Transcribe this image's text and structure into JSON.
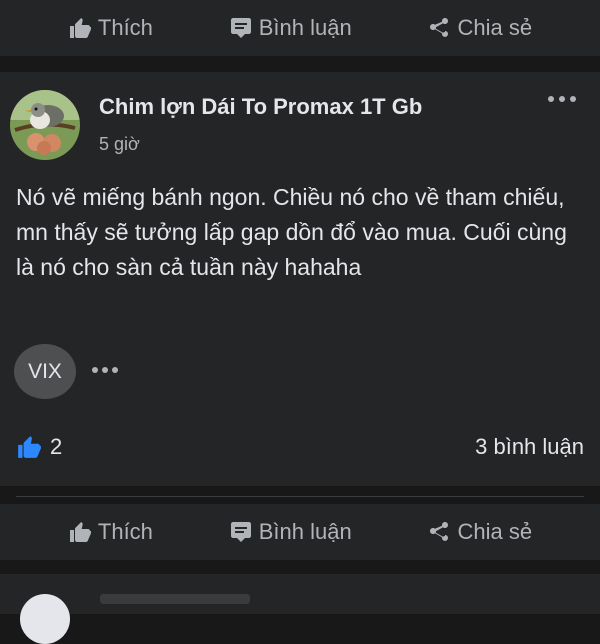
{
  "top_actions": {
    "like_label": "Thích",
    "comment_label": "Bình luận",
    "share_label": "Chia sẻ"
  },
  "post": {
    "author": "Chim lợn Dái To Promax 1T Gb",
    "time": "5 giờ",
    "body": "Nó vẽ miếng bánh ngon. Chiều nó cho về tham chiếu, mn thấy sẽ tưởng lấp gap dồn đổ vào mua. Cuối cùng là nó cho sàn cả tuần này hahaha",
    "tag": "VIX",
    "like_count": "2",
    "comment_count": "3 bình luận"
  },
  "bottom_actions": {
    "like_label": "Thích",
    "comment_label": "Bình luận",
    "share_label": "Chia sẻ"
  },
  "colors": {
    "background": "#181818",
    "card": "#242526",
    "text": "#e4e6eb",
    "muted": "#b0b3b8",
    "like_blue": "#2d88ff"
  }
}
